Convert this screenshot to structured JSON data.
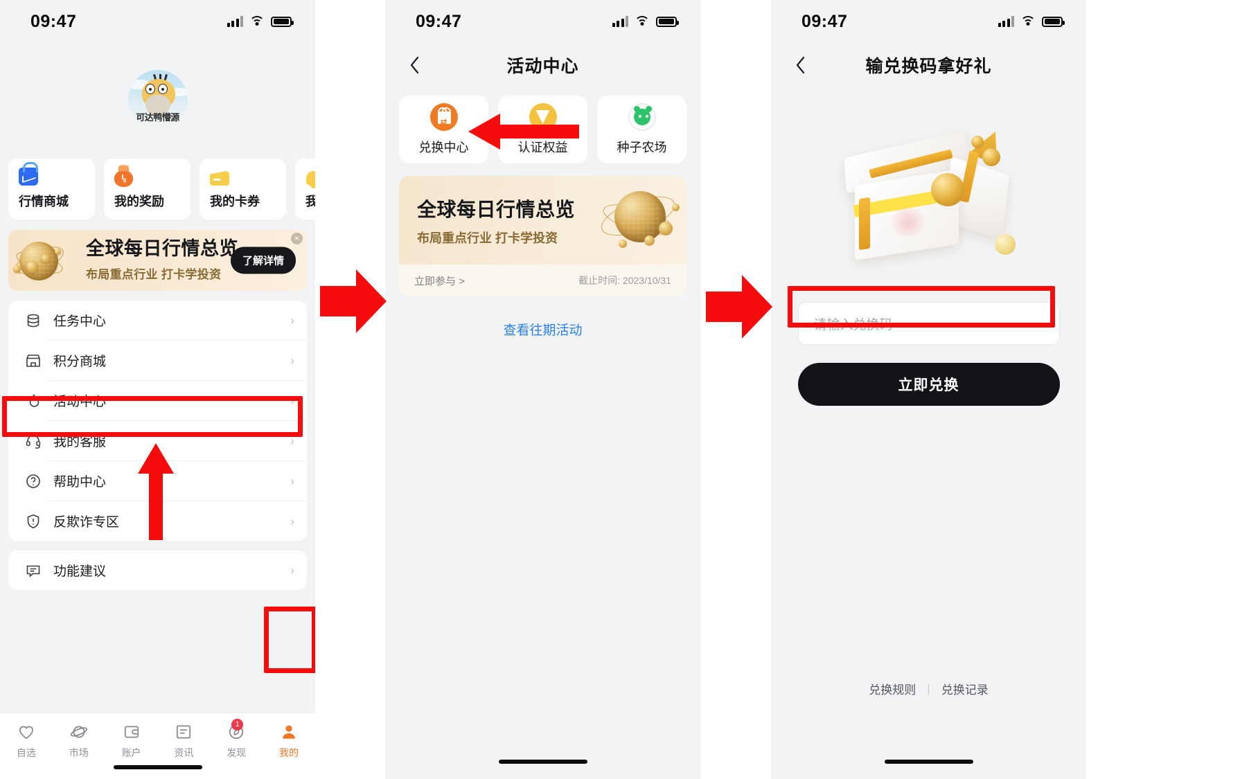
{
  "status_bar": {
    "time": "09:47"
  },
  "phone1": {
    "avatar_label": "可达鸭懵源",
    "quick_cards": [
      {
        "label": "行情商城",
        "icon": "shop-icon"
      },
      {
        "label": "我的奖励",
        "icon": "money-bag-icon"
      },
      {
        "label": "我的卡券",
        "icon": "card-coupon-icon"
      },
      {
        "label": "我的提",
        "icon": "bell-icon"
      }
    ],
    "promo": {
      "title": "全球每日行情总览",
      "subtitle": "布局重点行业 打卡学投资",
      "button": "了解详情",
      "close": "×"
    },
    "menu_group_1": [
      {
        "label": "任务中心",
        "icon": "database-icon",
        "arrow": "›"
      },
      {
        "label": "积分商城",
        "icon": "store-icon",
        "arrow": "›"
      },
      {
        "label": "活动中心",
        "icon": "fire-icon",
        "arrow": "›",
        "highlighted": true
      },
      {
        "label": "我的客服",
        "icon": "headset-icon",
        "arrow": "›"
      },
      {
        "label": "帮助中心",
        "icon": "question-circle-icon",
        "arrow": "›"
      },
      {
        "label": "反欺诈专区",
        "icon": "shield-alert-icon",
        "arrow": "›"
      }
    ],
    "menu_group_2": [
      {
        "label": "功能建议",
        "icon": "feedback-icon",
        "arrow": "›"
      }
    ],
    "tabbar": [
      {
        "label": "自选",
        "icon": "heart-icon",
        "active": false,
        "badge": ""
      },
      {
        "label": "市场",
        "icon": "planet-icon",
        "active": false,
        "badge": ""
      },
      {
        "label": "账户",
        "icon": "wallet-icon",
        "active": false,
        "badge": ""
      },
      {
        "label": "资讯",
        "icon": "news-icon",
        "active": false,
        "badge": ""
      },
      {
        "label": "发现",
        "icon": "compass-icon",
        "active": false,
        "badge": "1"
      },
      {
        "label": "我的",
        "icon": "person-icon",
        "active": true,
        "badge": ""
      }
    ]
  },
  "phone2": {
    "nav": {
      "back": "‹",
      "title": "活动中心"
    },
    "cards": [
      {
        "label": "兑换中心",
        "icon": "gift-exchange-icon"
      },
      {
        "label": "认证权益",
        "icon": "coin-badge-icon"
      },
      {
        "label": "种子农场",
        "icon": "seed-farm-icon"
      }
    ],
    "banner": {
      "title": "全球每日行情总览",
      "subtitle": "布局重点行业 打卡学投资",
      "join": "立即参与 >",
      "deadline": "截止时间: 2023/10/31"
    },
    "past_link": "查看往期活动"
  },
  "phone3": {
    "nav": {
      "back": "‹",
      "title": "输兑换码拿好礼"
    },
    "input_placeholder": "请输入兑换码",
    "input_value": "",
    "submit_label": "立即兑换",
    "footer_links": [
      "兑换规则",
      "兑换记录"
    ],
    "footer_separator": "|"
  },
  "annotations": {
    "highlight_color": "#f60c0c",
    "arrow_color": "#f60c0c"
  }
}
